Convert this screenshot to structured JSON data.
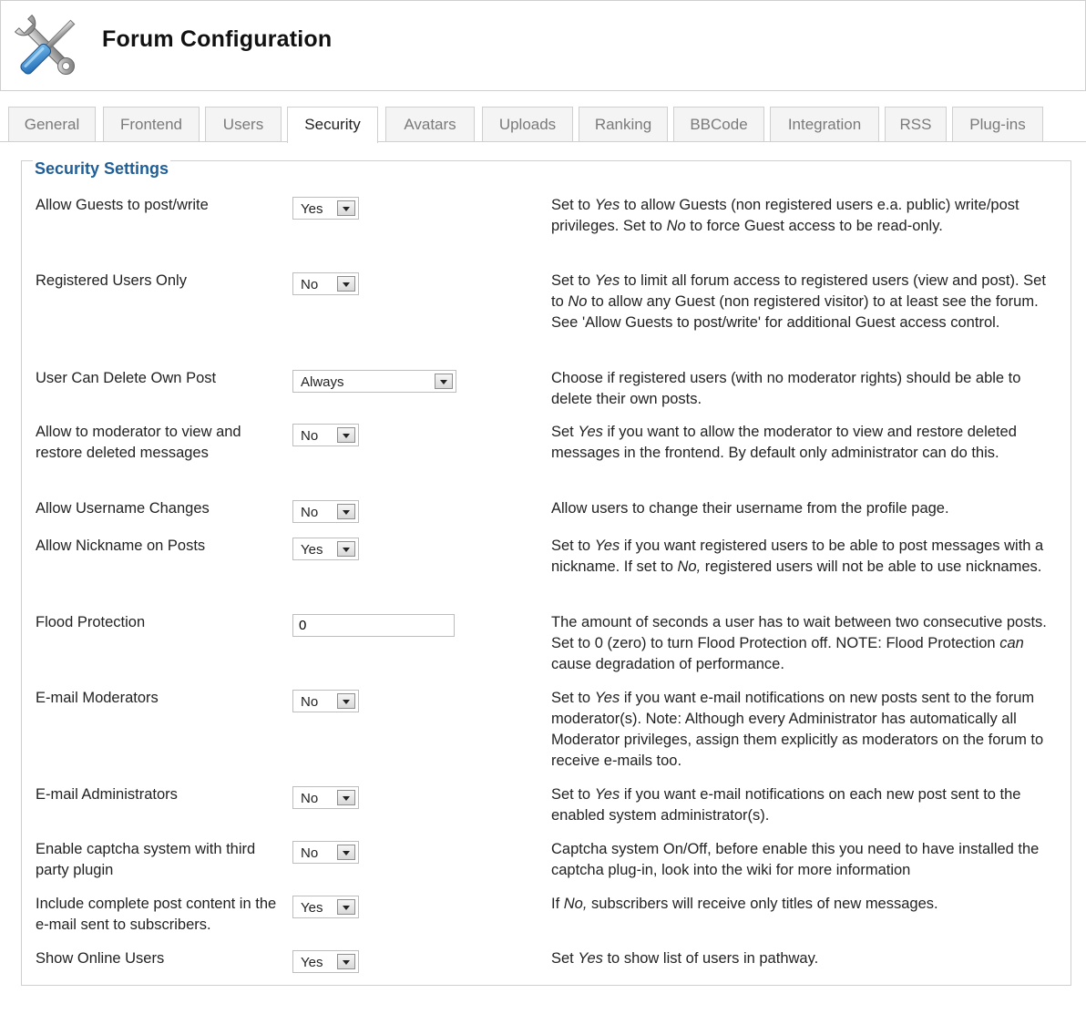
{
  "header": {
    "title": "Forum Configuration",
    "icon": "tools-icon"
  },
  "tabs": [
    {
      "label": "General",
      "active": false
    },
    {
      "label": "Frontend",
      "active": false
    },
    {
      "label": "Users",
      "active": false
    },
    {
      "label": "Security",
      "active": true
    },
    {
      "label": "Avatars",
      "active": false
    },
    {
      "label": "Uploads",
      "active": false
    },
    {
      "label": "Ranking",
      "active": false
    },
    {
      "label": "BBCode",
      "active": false
    },
    {
      "label": "Integration",
      "active": false
    },
    {
      "label": "RSS",
      "active": false
    },
    {
      "label": "Plug-ins",
      "active": false
    }
  ],
  "section": {
    "legend": "Security Settings"
  },
  "settings": [
    {
      "label": "Allow Guests to post/write",
      "control": "select",
      "value": "Yes",
      "desc": [
        "Set to ",
        {
          "i": "Yes"
        },
        " to allow Guests (non registered users e.a. public) write/post privileges. Set to ",
        {
          "i": "No"
        },
        " to force Guest access to be read-only."
      ]
    },
    {
      "label": "Registered Users Only",
      "control": "select",
      "value": "No",
      "desc": [
        "Set to ",
        {
          "i": "Yes"
        },
        " to limit all forum access to registered users (view and post). Set to ",
        {
          "i": "No"
        },
        " to allow any Guest (non registered visitor) to at least see the forum. See 'Allow Guests to post/write' for additional Guest access control."
      ]
    },
    {
      "label": "User Can Delete Own Post",
      "control": "select-wide",
      "value": "Always",
      "desc": [
        "Choose if registered users (with no moderator rights) should be able to delete their own posts."
      ]
    },
    {
      "label": "Allow to moderator to view and restore deleted messages",
      "control": "select",
      "value": "No",
      "desc": [
        "Set ",
        {
          "i": "Yes"
        },
        " if you want to allow the moderator to view and restore deleted messages in the frontend. By default only administrator can do this."
      ]
    },
    {
      "label": "Allow Username Changes",
      "control": "select",
      "value": "No",
      "desc": [
        "Allow users to change their username from the profile page."
      ]
    },
    {
      "label": "Allow Nickname on Posts",
      "control": "select",
      "value": "Yes",
      "desc": [
        "Set to ",
        {
          "i": "Yes"
        },
        " if you want registered users to be able to post messages with a nickname. If set to ",
        {
          "i": "No,"
        },
        " registered users will not be able to use nicknames."
      ]
    },
    {
      "label": "Flood Protection",
      "control": "text",
      "value": "0",
      "desc": [
        "The amount of seconds a user has to wait between two consecutive posts. Set to 0 (zero) to turn Flood Protection off. NOTE: Flood Protection ",
        {
          "i": "can"
        },
        " cause degradation of performance."
      ]
    },
    {
      "label": "E-mail Moderators",
      "control": "select",
      "value": "No",
      "desc": [
        "Set to ",
        {
          "i": "Yes"
        },
        " if you want e-mail notifications on new posts sent to the forum moderator(s). Note: Although every Administrator has automatically all Moderator privileges, assign them explicitly as moderators on the forum to receive e-mails too."
      ]
    },
    {
      "label": "E-mail Administrators",
      "control": "select",
      "value": "No",
      "desc": [
        "Set to ",
        {
          "i": "Yes"
        },
        " if you want e-mail notifications on each new post sent to the enabled system administrator(s)."
      ]
    },
    {
      "label": "Enable captcha system with third party plugin",
      "control": "select",
      "value": "No",
      "desc": [
        "Captcha system On/Off, before enable this you need to have installed the captcha plug-in, look into the wiki for more information"
      ]
    },
    {
      "label": "Include complete post content in the e-mail sent to subscribers.",
      "control": "select",
      "value": "Yes",
      "desc": [
        "If ",
        {
          "i": "No,"
        },
        " subscribers will receive only titles of new messages."
      ]
    },
    {
      "label": "Show Online Users",
      "control": "select",
      "value": "Yes",
      "desc": [
        "Set ",
        {
          "i": "Yes"
        },
        " to show list of users in pathway."
      ]
    }
  ]
}
